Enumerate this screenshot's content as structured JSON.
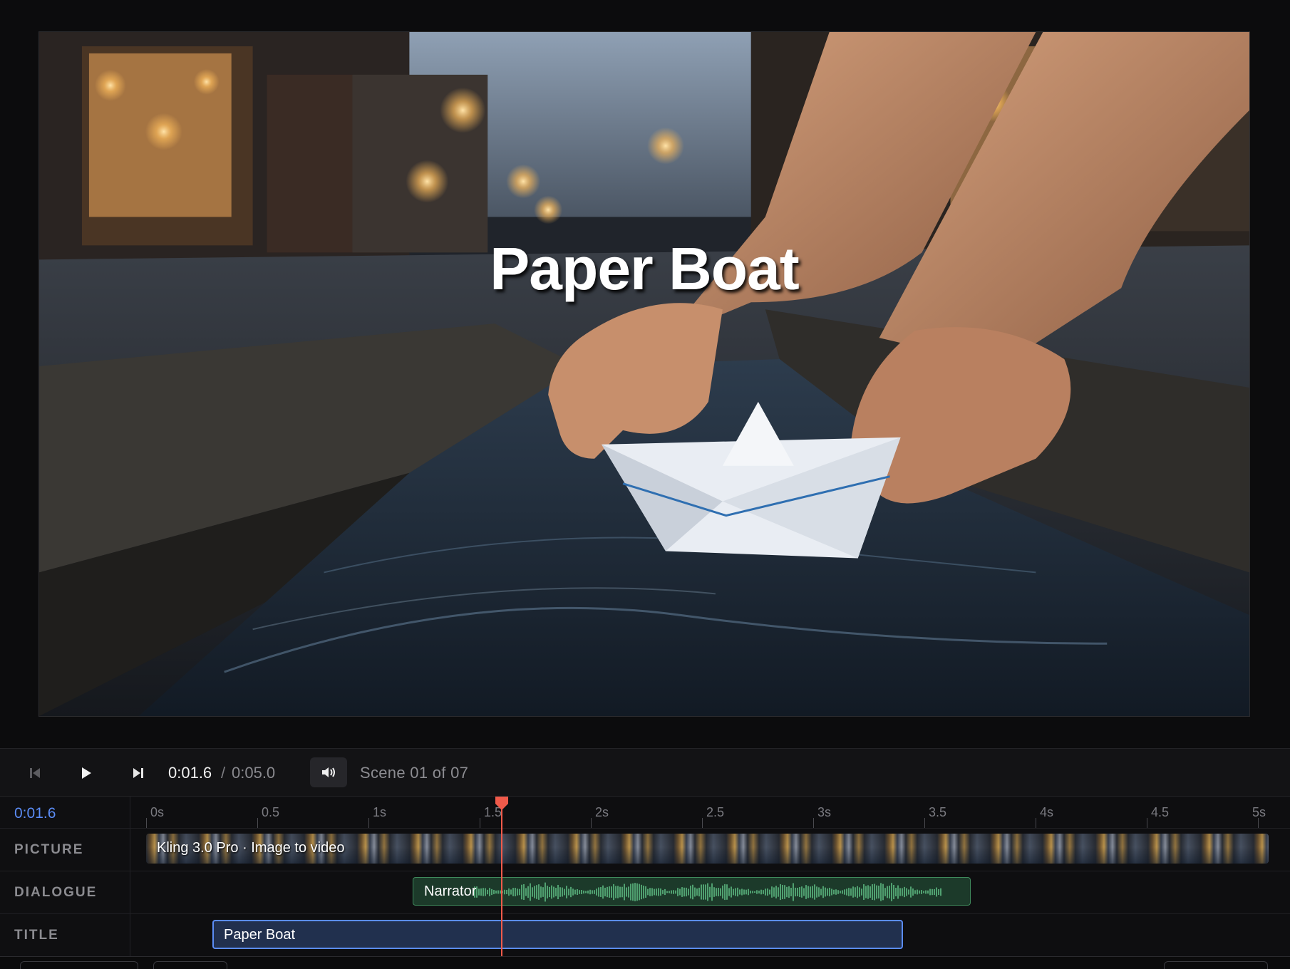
{
  "preview": {
    "overlay_title": "Paper Boat"
  },
  "transport": {
    "current_time": "0:01.6",
    "separator": "/",
    "total_time": "0:05.0",
    "scene_label": "Scene 01 of 07",
    "icons": [
      "skip-back-icon",
      "play-icon",
      "skip-forward-icon",
      "volume-icon"
    ]
  },
  "timeline": {
    "current_time": "0:01.6",
    "playhead_seconds": 1.6,
    "duration_seconds": 5,
    "ruler": [
      {
        "t": 0,
        "label": "0s"
      },
      {
        "t": 0.5,
        "label": "0.5"
      },
      {
        "t": 1,
        "label": "1s"
      },
      {
        "t": 1.5,
        "label": "1.5"
      },
      {
        "t": 2,
        "label": "2s"
      },
      {
        "t": 2.5,
        "label": "2.5"
      },
      {
        "t": 3,
        "label": "3s"
      },
      {
        "t": 3.5,
        "label": "3.5"
      },
      {
        "t": 4,
        "label": "4s"
      },
      {
        "t": 4.5,
        "label": "4.5"
      },
      {
        "t": 5,
        "label": "5s"
      }
    ],
    "tracks": {
      "picture": {
        "label": "PICTURE",
        "clip_label": "Kling 3.0 Pro · Image to video"
      },
      "dialogue": {
        "label": "DIALOGUE",
        "clip_label": "Narrator"
      },
      "title": {
        "label": "TITLE",
        "clip_label": "Paper Boat"
      }
    }
  },
  "colors": {
    "accent": "#5b8cf5",
    "playhead": "#f05a4a",
    "dialogue_clip": "#1c3a2a",
    "dialogue_wave": "#59b37c",
    "title_clip": "#21304e"
  }
}
